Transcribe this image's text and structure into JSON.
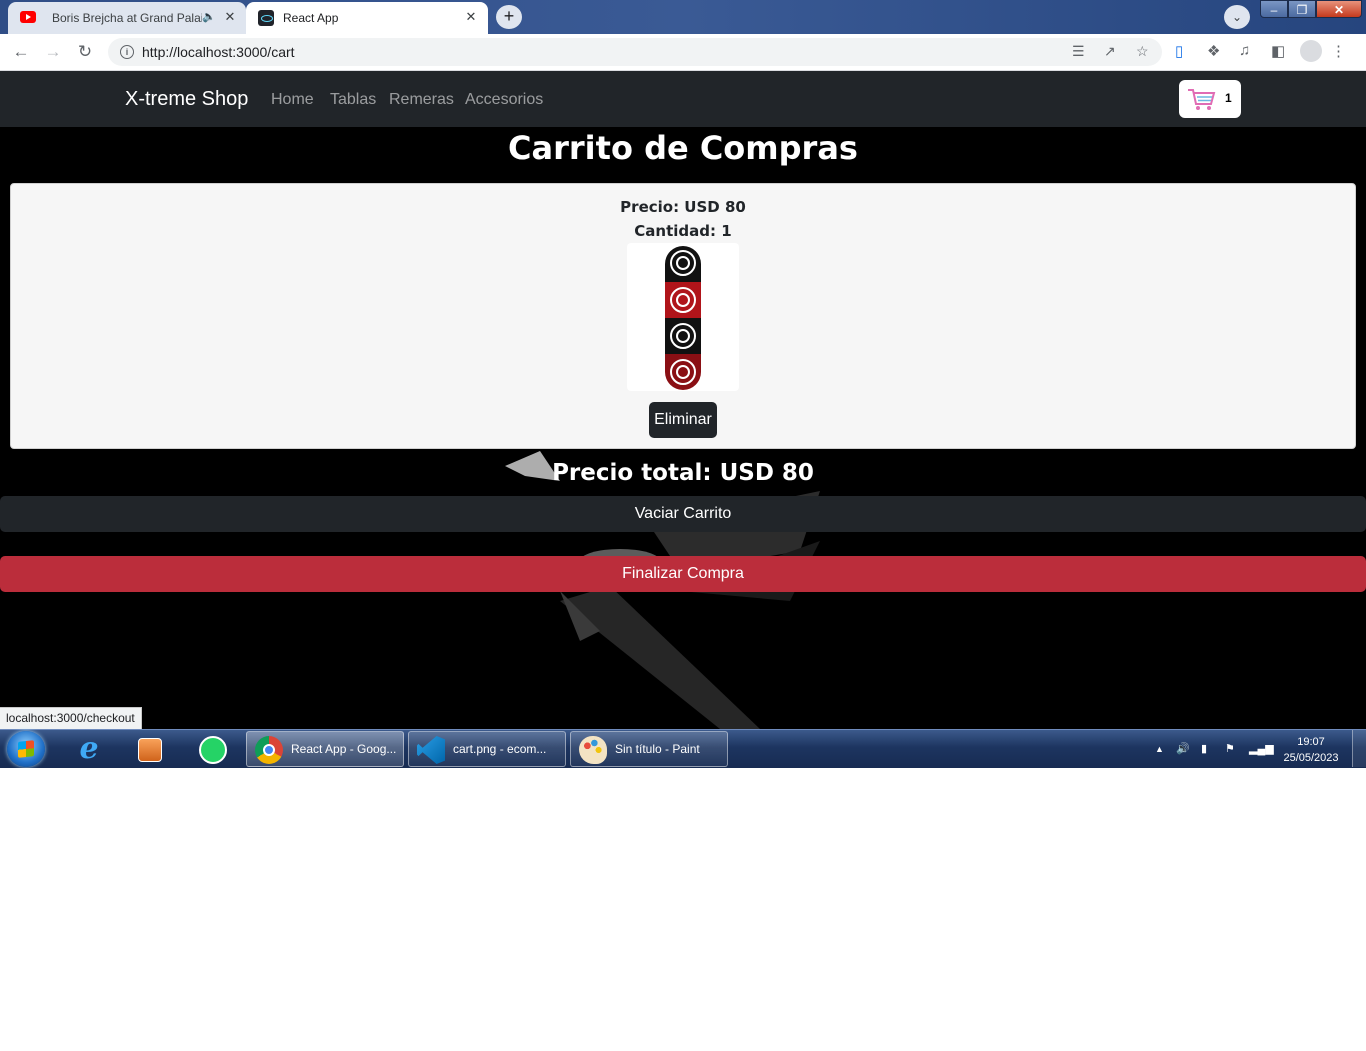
{
  "browser": {
    "tabs": [
      {
        "title": "Boris Brejcha at Grand Palais",
        "icon": "youtube-icon",
        "audio": true
      },
      {
        "title": "React App",
        "icon": "react-icon",
        "active": true
      }
    ],
    "url": "http://localhost:3000/cart",
    "status_url": "localhost:3000/checkout"
  },
  "navbar": {
    "brand": "X-treme Shop",
    "links": [
      "Home",
      "Tablas",
      "Remeras",
      "Accesorios"
    ],
    "cart_count": "1"
  },
  "page": {
    "title": "Carrito de Compras",
    "item": {
      "price": "Precio: USD 80",
      "quantity": "Cantidad: 1",
      "image_alt": "skateboard-deck-image"
    },
    "remove_label": "Eliminar",
    "total": "Precio total: USD 80",
    "empty_label": "Vaciar Carrito",
    "checkout_label": "Finalizar Compra"
  },
  "colors": {
    "navbar": "#212529",
    "danger": "#bb2d3b",
    "card": "#f6f6f6"
  },
  "taskbar": {
    "tasks": [
      {
        "label": "React App - Goog...",
        "icon": "chrome-icon"
      },
      {
        "label": "cart.png - ecom...",
        "icon": "vscode-icon"
      },
      {
        "label": "Sin título - Paint",
        "icon": "paint-icon"
      }
    ],
    "time": "19:07",
    "date": "25/05/2023"
  }
}
